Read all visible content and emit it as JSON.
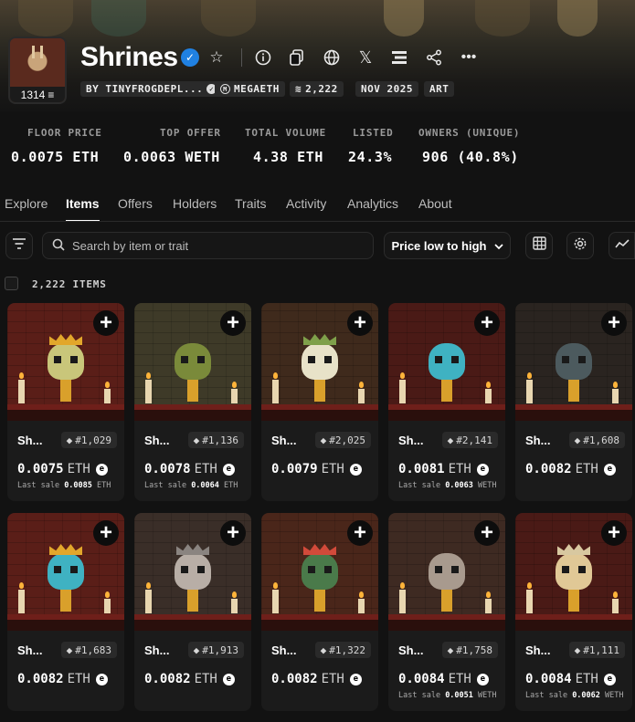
{
  "collection": {
    "name": "Shrines",
    "avatar_count": "1314",
    "chips": {
      "creator": "BY TINYFROGDEPL...",
      "chain": "MEGAETH",
      "supply": "2,222",
      "date": "NOV 2025",
      "category": "ART"
    }
  },
  "header_icons": [
    "star-icon",
    "info-icon",
    "copy-icon",
    "globe-icon",
    "x-icon",
    "platform-icon",
    "share-icon",
    "more-icon"
  ],
  "stats": [
    {
      "label": "FLOOR PRICE",
      "value": "0.0075 ETH"
    },
    {
      "label": "TOP OFFER",
      "value": "0.0063 WETH"
    },
    {
      "label": "TOTAL VOLUME",
      "value": "4.38 ETH"
    },
    {
      "label": "LISTED",
      "value": "24.3%"
    },
    {
      "label": "OWNERS (UNIQUE)",
      "value": "906 (40.8%)"
    }
  ],
  "tabs": [
    "Explore",
    "Items",
    "Offers",
    "Holders",
    "Traits",
    "Activity",
    "Analytics",
    "About"
  ],
  "active_tab": "Items",
  "toolbar": {
    "search_placeholder": "Search by item or trait",
    "sort_label": "Price low to high"
  },
  "items_count": "2,222 ITEMS",
  "items": [
    {
      "name": "Sh...",
      "token": "#1,029",
      "price": "0.0075",
      "currency": "ETH",
      "last_label": "Last sale",
      "last_value": "0.0085",
      "last_currency": "ETH",
      "wall": "#5a1e18",
      "skull": "#c9c67a",
      "crown": "#e2a72b"
    },
    {
      "name": "Sh...",
      "token": "#1,136",
      "price": "0.0078",
      "currency": "ETH",
      "last_label": "Last sale",
      "last_value": "0.0064",
      "last_currency": "ETH",
      "wall": "#3e3a28",
      "skull": "#7a8a3a",
      "crown": ""
    },
    {
      "name": "Sh...",
      "token": "#2,025",
      "price": "0.0079",
      "currency": "ETH",
      "last_label": "",
      "last_value": "",
      "last_currency": "",
      "wall": "#3f2a1c",
      "skull": "#e8e2c8",
      "crown": "#7fa04a"
    },
    {
      "name": "Sh...",
      "token": "#2,141",
      "price": "0.0081",
      "currency": "ETH",
      "last_label": "Last sale",
      "last_value": "0.0063",
      "last_currency": "WETH",
      "wall": "#4a1a16",
      "skull": "#3fb2c2",
      "crown": ""
    },
    {
      "name": "Sh...",
      "token": "#1,608",
      "price": "0.0082",
      "currency": "ETH",
      "last_label": "",
      "last_value": "",
      "last_currency": "",
      "wall": "#2a2420",
      "skull": "#4c5a5e",
      "crown": ""
    },
    {
      "name": "Sh...",
      "token": "#1,683",
      "price": "0.0082",
      "currency": "ETH",
      "last_label": "",
      "last_value": "",
      "last_currency": "",
      "wall": "#5a1e18",
      "skull": "#3fb2c2",
      "crown": "#e2a72b"
    },
    {
      "name": "Sh...",
      "token": "#1,913",
      "price": "0.0082",
      "currency": "ETH",
      "last_label": "",
      "last_value": "",
      "last_currency": "",
      "wall": "#3a2e28",
      "skull": "#b8aea6",
      "crown": "#8a8480"
    },
    {
      "name": "Sh...",
      "token": "#1,322",
      "price": "0.0082",
      "currency": "ETH",
      "last_label": "",
      "last_value": "",
      "last_currency": "",
      "wall": "#4a261a",
      "skull": "#4a7a4a",
      "crown": "#d24a3a"
    },
    {
      "name": "Sh...",
      "token": "#1,758",
      "price": "0.0084",
      "currency": "ETH",
      "last_label": "Last sale",
      "last_value": "0.0051",
      "last_currency": "WETH",
      "wall": "#3e2a22",
      "skull": "#a89a8e",
      "crown": ""
    },
    {
      "name": "Sh...",
      "token": "#1,111",
      "price": "0.0084",
      "currency": "ETH",
      "last_label": "Last sale",
      "last_value": "0.0062",
      "last_currency": "WETH",
      "wall": "#4a1a16",
      "skull": "#e0c896",
      "crown": "#d8c8a0"
    }
  ]
}
